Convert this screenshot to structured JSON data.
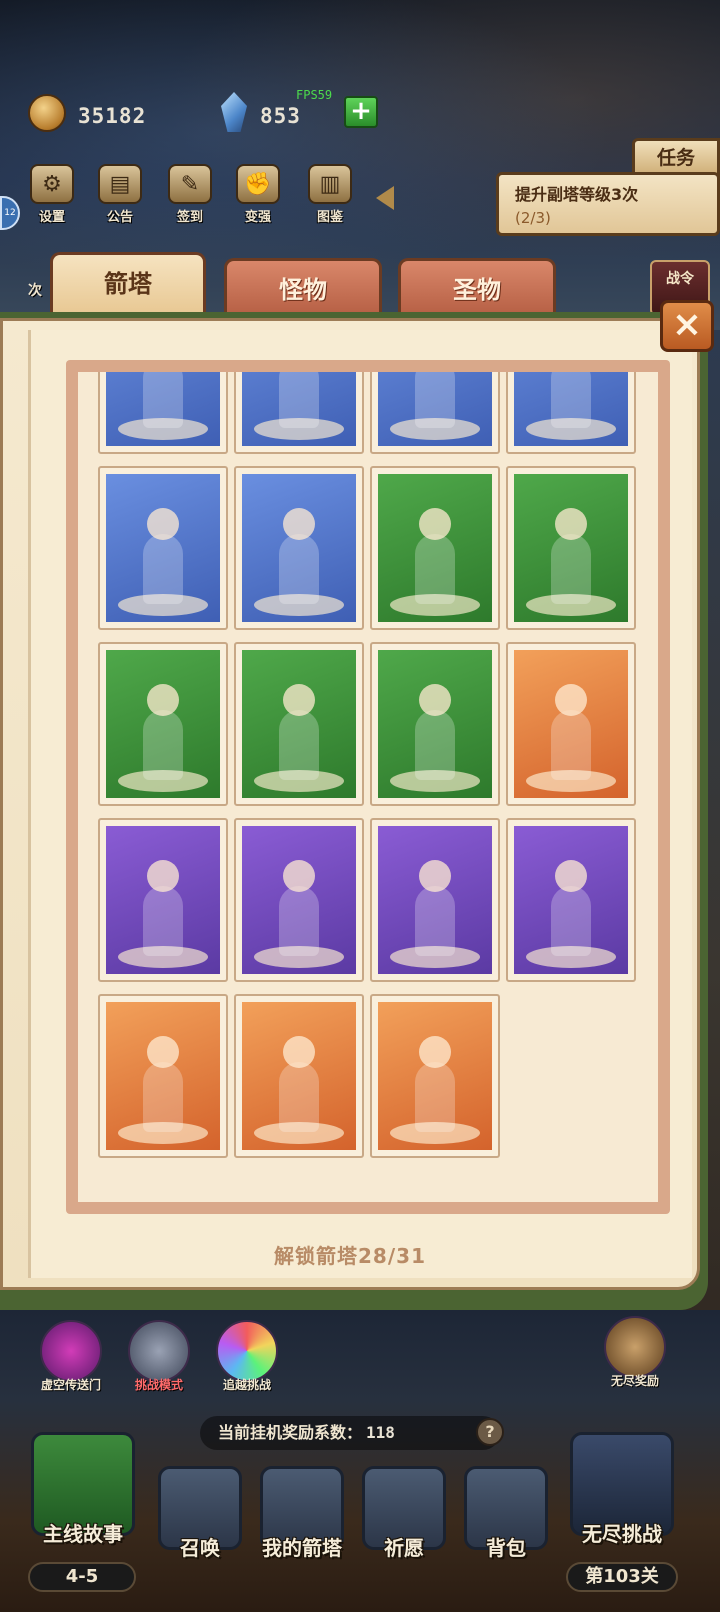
{
  "hud": {
    "gold": "35182",
    "gems": "853",
    "fps": "FPS59",
    "plus_label": "+"
  },
  "top_menu": [
    {
      "label": "设置",
      "icon": "gear-icon"
    },
    {
      "label": "公告",
      "icon": "notice-icon"
    },
    {
      "label": "签到",
      "icon": "scroll-icon"
    },
    {
      "label": "变强",
      "icon": "fist-icon"
    },
    {
      "label": "图鉴",
      "icon": "book-icon"
    }
  ],
  "task": {
    "tag": "任务",
    "title": "提升副塔等级3次",
    "progress": "(2/3)"
  },
  "side": {
    "left_badge": "12",
    "left_label": "次",
    "right_label": "战令"
  },
  "tabs": [
    {
      "label": "箭塔",
      "active": true
    },
    {
      "label": "怪物",
      "active": false
    },
    {
      "label": "圣物",
      "active": false
    }
  ],
  "close_label": "×",
  "cards": [
    {
      "color": "blue"
    },
    {
      "color": "blue"
    },
    {
      "color": "blue"
    },
    {
      "color": "blue"
    },
    {
      "color": "blue"
    },
    {
      "color": "blue"
    },
    {
      "color": "green"
    },
    {
      "color": "green"
    },
    {
      "color": "green"
    },
    {
      "color": "green"
    },
    {
      "color": "green"
    },
    {
      "color": "orange"
    },
    {
      "color": "purple"
    },
    {
      "color": "purple"
    },
    {
      "color": "purple"
    },
    {
      "color": "purple"
    },
    {
      "color": "orange"
    },
    {
      "color": "orange"
    },
    {
      "color": "orange"
    }
  ],
  "unlock_text": "解锁箭塔28/31",
  "modes": [
    {
      "label": "虚空传送门"
    },
    {
      "label": "挑战模式"
    },
    {
      "label": "追越挑战"
    },
    {
      "label": "无尽奖励"
    }
  ],
  "reward": {
    "label": "当前挂机奖励系数：",
    "value": "118",
    "help": "?"
  },
  "bottom_nav": [
    {
      "label": "主线故事",
      "sub": "4-5"
    },
    {
      "label": "召唤"
    },
    {
      "label": "我的箭塔"
    },
    {
      "label": "祈愿"
    },
    {
      "label": "背包"
    },
    {
      "label": "无尽挑战",
      "sub": "第103关"
    }
  ]
}
